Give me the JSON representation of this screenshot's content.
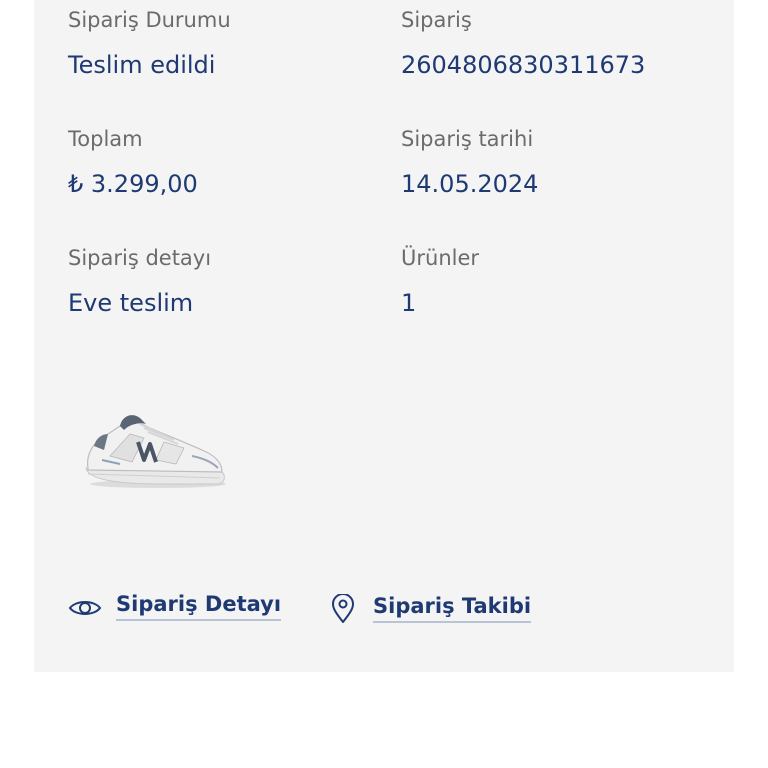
{
  "order": {
    "status_label": "Sipariş Durumu",
    "status_value": "Teslim edildi",
    "number_label": "Sipariş",
    "number_value": "2604806830311673",
    "total_label": "Toplam",
    "total_value": "₺ 3.299,00",
    "date_label": "Sipariş tarihi",
    "date_value": "14.05.2024",
    "detail_label": "Sipariş detayı",
    "detail_value": "Eve teslim",
    "products_label": "Ürünler",
    "products_value": "1"
  },
  "product": {
    "image_icon": "sneaker-image"
  },
  "actions": {
    "detail_label": "Sipariş Detayı",
    "detail_icon": "eye-icon",
    "tracking_label": "Sipariş Takibi",
    "tracking_icon": "location-pin-icon"
  },
  "colors": {
    "card_background": "#f4f4f5",
    "label": "#6b6b6b",
    "value": "#1f3a73",
    "link_underline": "#b9c3d6"
  }
}
